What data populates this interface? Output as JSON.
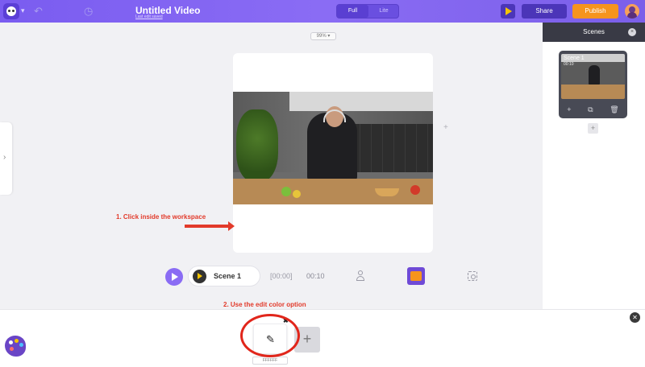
{
  "header": {
    "title": "Untitled Video",
    "subtitle": "Last edit saved",
    "mode_full": "Full",
    "mode_lite": "Lite",
    "share_label": "Share",
    "publish_label": "Publish"
  },
  "workspace": {
    "zoom": "99%",
    "zoom_caret": "▾",
    "plus": "+"
  },
  "annotations": {
    "step1": "1. Click inside the workspace",
    "step2": "2. Use the edit color option"
  },
  "timeline": {
    "scene_label": "Scene 1",
    "start": "[00:00]",
    "duration": "00:10"
  },
  "scenes_panel": {
    "title": "Scenes",
    "close": "×",
    "cards": [
      {
        "name": "Scene 1",
        "time": "00:10",
        "add": "+",
        "duplicate": "⧉",
        "delete": "🗑"
      }
    ],
    "add": "+"
  },
  "color_panel": {
    "swatch_hex": "FFFFFF",
    "remove": "✖",
    "pencil": "✎",
    "add": "+",
    "close": "✕"
  },
  "left_tab": {
    "arrow": "›"
  },
  "colors": {
    "accent": "#8a6cf4",
    "publish": "#f6941d",
    "annotation": "#e23a2a"
  }
}
